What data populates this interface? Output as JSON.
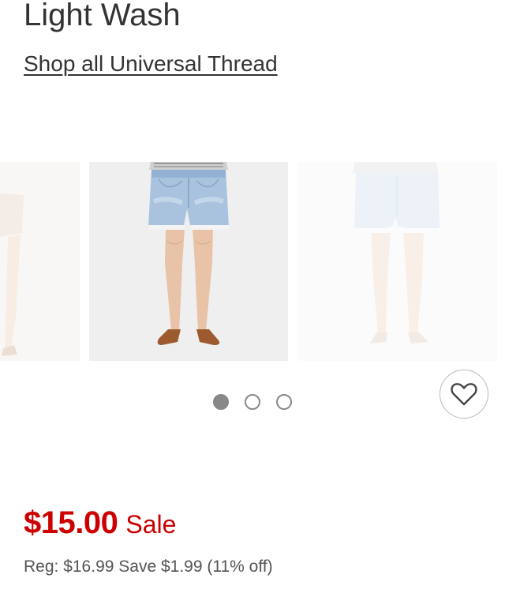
{
  "product": {
    "title": "Light Wash",
    "brand_link": "Shop all Universal Thread"
  },
  "carousel": {
    "slide_count": 3,
    "active_index": 0,
    "slides": [
      {
        "name": "previous-product-image"
      },
      {
        "name": "front-view-image"
      },
      {
        "name": "back-view-image"
      }
    ]
  },
  "favorite": {
    "icon": "heart-outline-icon"
  },
  "pricing": {
    "price": "$15.00",
    "sale_label": "Sale",
    "regular": "Reg: $16.99 Save $1.99 (11% off)"
  },
  "colors": {
    "sale_red": "#cc0000",
    "text_dark": "#333333",
    "text_gray": "#555555",
    "dot_gray": "#888888",
    "image_bg": "#efefef"
  }
}
